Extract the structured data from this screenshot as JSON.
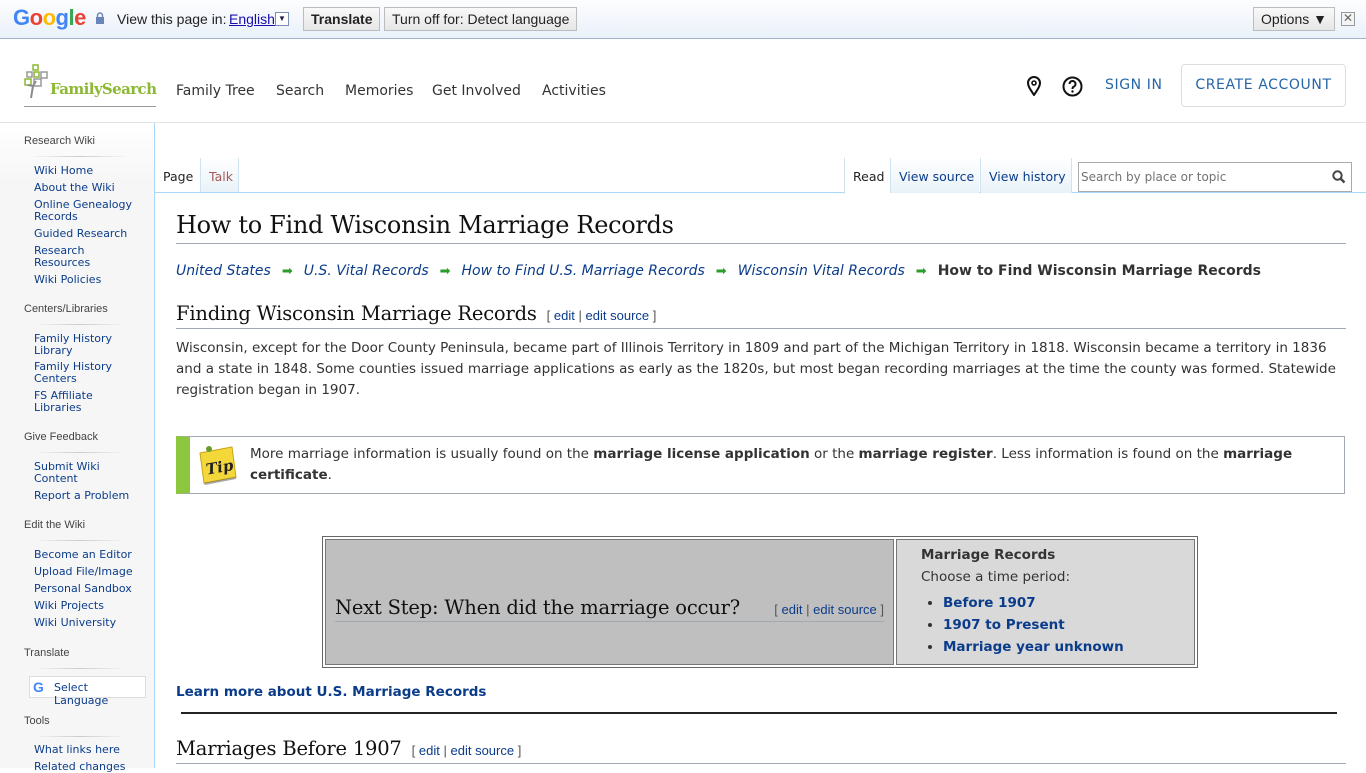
{
  "translate_bar": {
    "logo": "Google",
    "view_label": "View this page in:",
    "language": "English",
    "translate_button": "Translate",
    "turn_off_button": "Turn off for: Detect language",
    "options_button": "Options ▼",
    "close": "✕"
  },
  "header": {
    "logo_text": "FamilySearch",
    "nav": [
      "Family Tree",
      "Search",
      "Memories",
      "Get Involved",
      "Activities"
    ],
    "sign_in": "SIGN IN",
    "create_account": "CREATE ACCOUNT",
    "icons": [
      "location-pin-icon",
      "help-icon"
    ]
  },
  "sidebar": {
    "sections": [
      {
        "title": "Research Wiki",
        "items": [
          "Wiki Home",
          "About the Wiki",
          "Online Genealogy Records",
          "Guided Research",
          "Research Resources",
          "Wiki Policies"
        ]
      },
      {
        "title": "Centers/Libraries",
        "items": [
          "Family History Library",
          "Family History Centers",
          "FS Affiliate Libraries"
        ]
      },
      {
        "title": "Give Feedback",
        "items": [
          "Submit Wiki Content",
          "Report a Problem"
        ]
      },
      {
        "title": "Edit the Wiki",
        "items": [
          "Become an Editor",
          "Upload File/Image",
          "Personal Sandbox",
          "Wiki Projects",
          "Wiki University"
        ]
      },
      {
        "title": "Translate",
        "items": []
      },
      {
        "title": "Tools",
        "items": [
          "What links here",
          "Related changes"
        ]
      }
    ],
    "select_language": "Select Language"
  },
  "tabs": {
    "left": [
      "Page",
      "Talk"
    ],
    "right": [
      "Read",
      "View source",
      "View history"
    ],
    "search_placeholder": "Search by place or topic"
  },
  "article": {
    "title": "How to Find Wisconsin Marriage Records",
    "breadcrumb": [
      "United States",
      "U.S. Vital Records",
      "How to Find U.S. Marriage Records",
      "Wisconsin Vital Records"
    ],
    "breadcrumb_current": "How to Find Wisconsin Marriage Records",
    "edit_links": {
      "open": "[",
      "edit": "edit",
      "sep": "|",
      "edit_source": "edit source",
      "close": "]"
    },
    "section1_title": "Finding Wisconsin Marriage Records",
    "section1_body": "Wisconsin, except for the Door County Peninsula, became part of Illinois Territory in 1809 and part of the Michigan Territory in 1818. Wisconsin became a territory in 1836 and a state in 1848. Some counties issued marriage applications as early as the 1820s, but most began recording marriages at the time the county was formed. Statewide registration began in 1907.",
    "tip": {
      "icon_label": "Tip",
      "t1": "More marriage information is usually found on the ",
      "b1": "marriage license application",
      "t2": " or the ",
      "b2": "marriage register",
      "t3": ". Less information is found on the ",
      "b3": "marriage certificate",
      "t4": "."
    },
    "next_step": {
      "question": "Next Step: When did the marriage occur?",
      "box_title": "Marriage Records",
      "box_subtitle": "Choose a time period:",
      "options": [
        "Before 1907",
        "1907 to Present",
        "Marriage year unknown"
      ]
    },
    "learn_more": "Learn more about U.S. Marriage Records",
    "section2_title": "Marriages Before 1907"
  }
}
